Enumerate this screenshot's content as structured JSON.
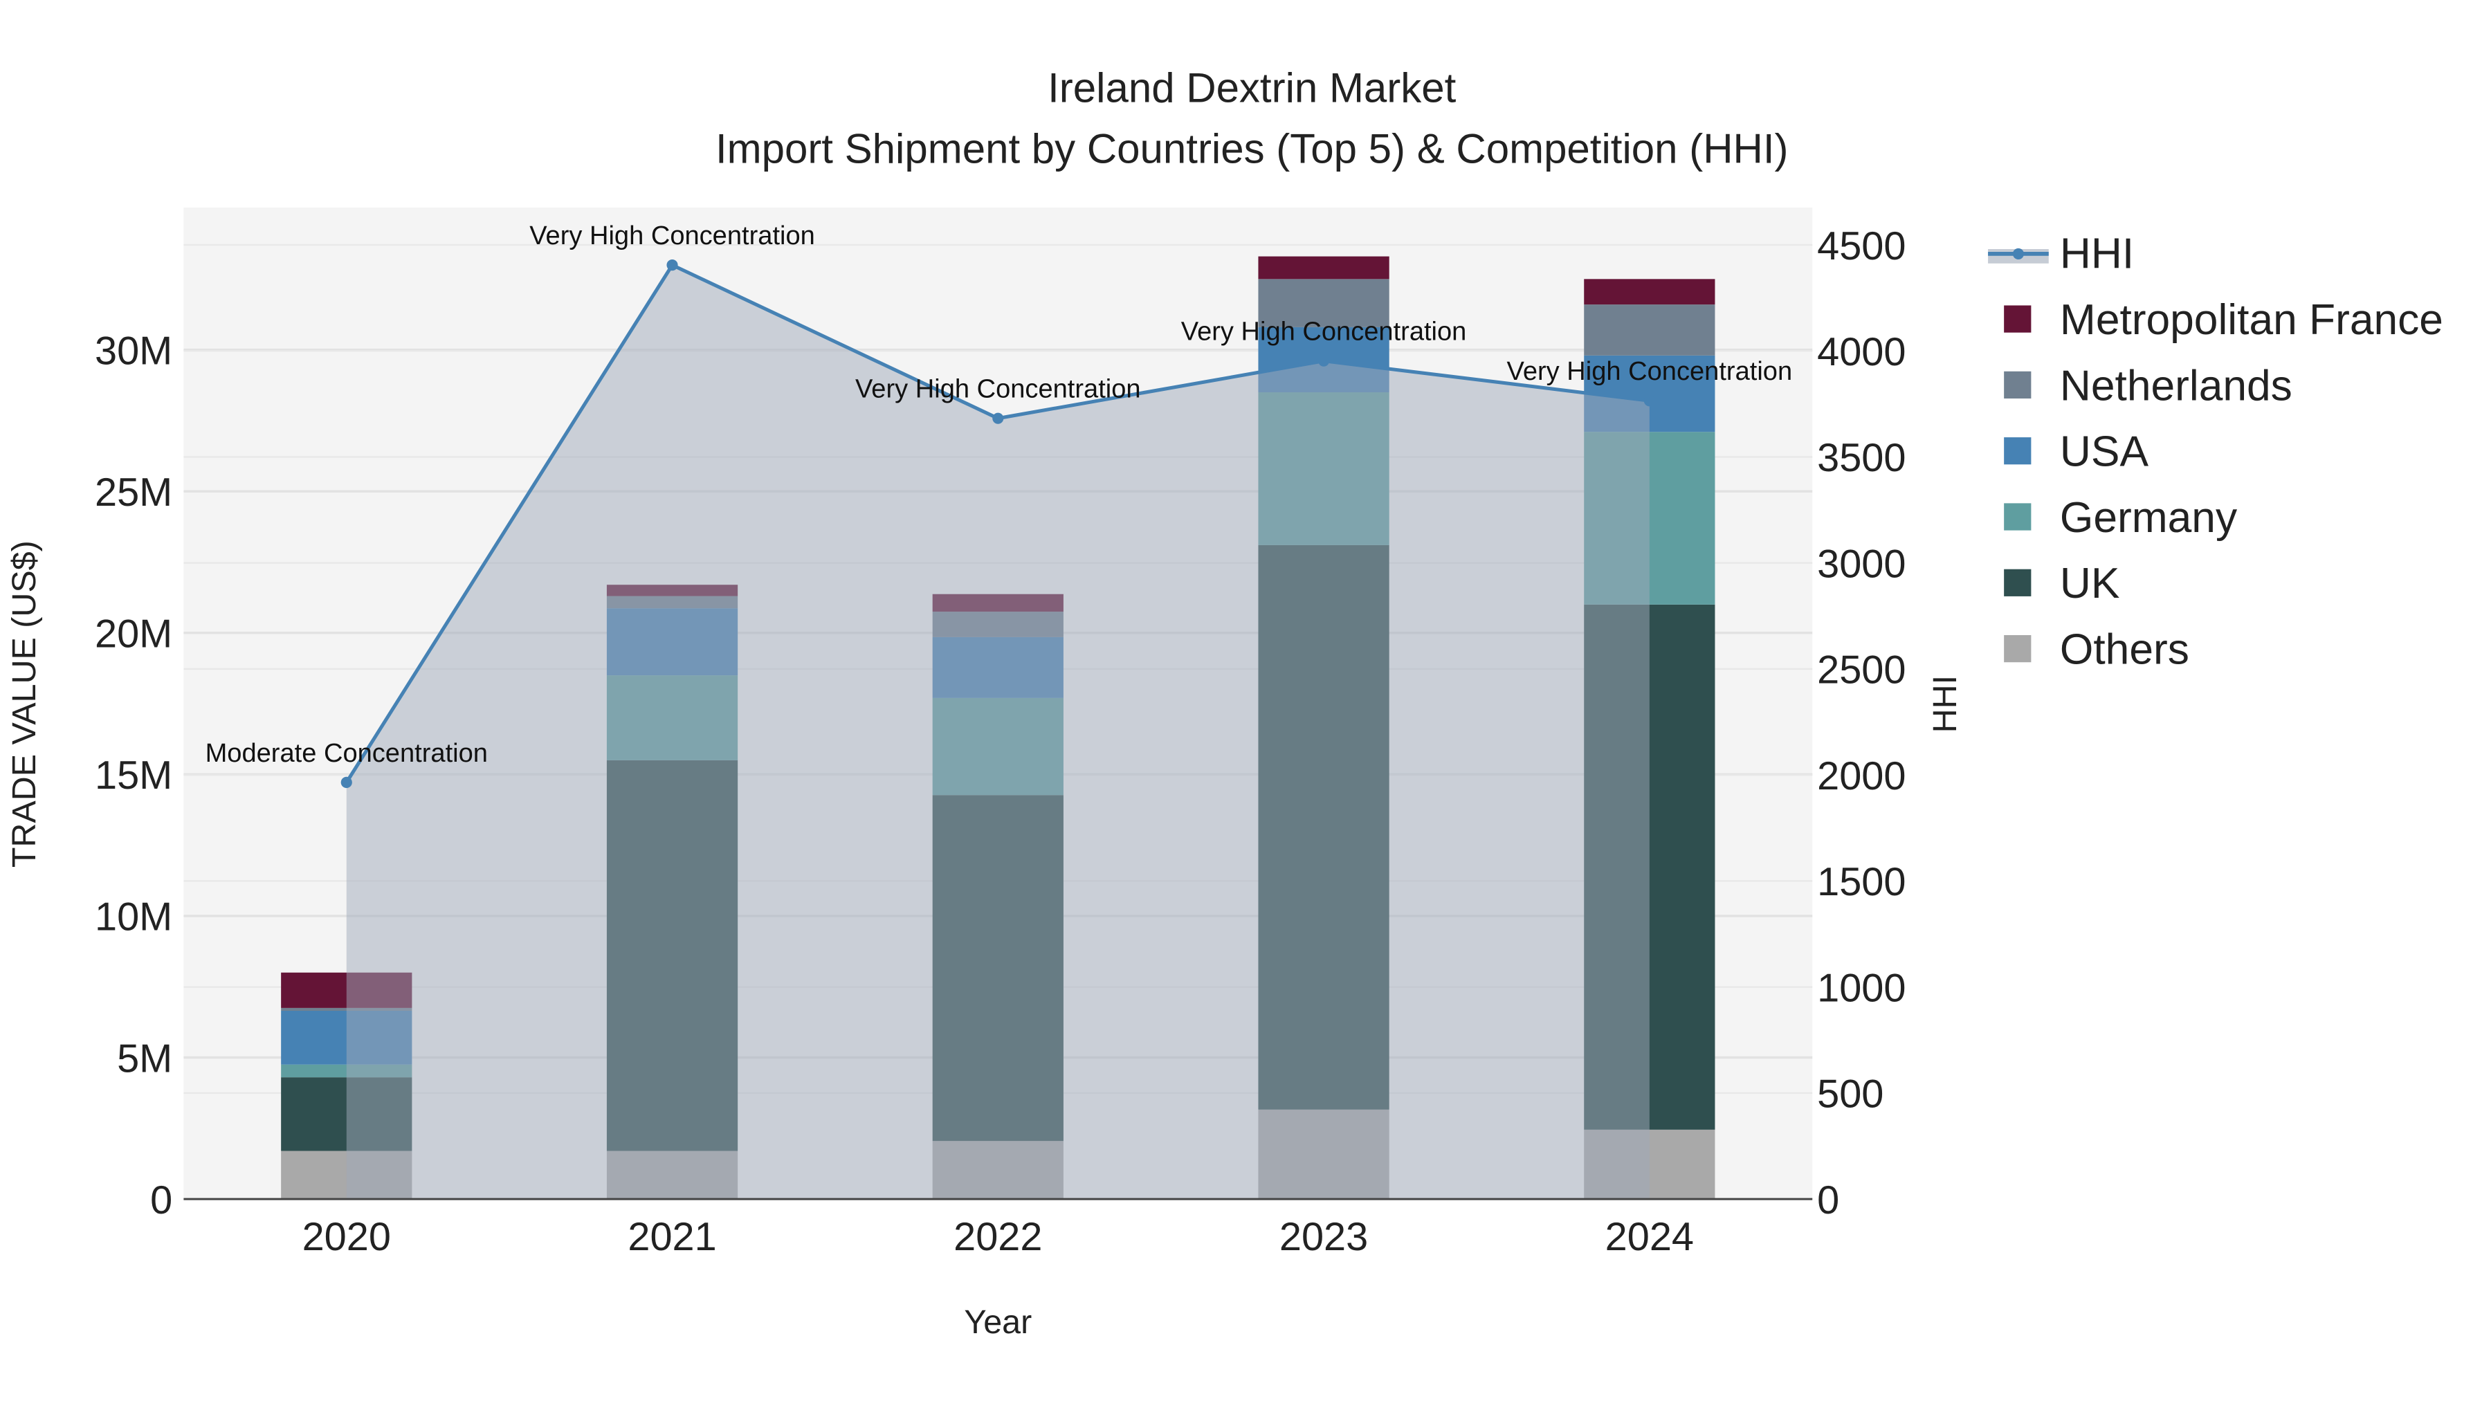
{
  "chart_data": {
    "type": "bar",
    "title": "Ireland Dextrin Market",
    "subtitle": "Import Shipment by Countries (Top 5) & Competition (HHI)",
    "xlabel": "Year",
    "ylabel": "TRADE VALUE (US$)",
    "y2label": "HHI",
    "categories": [
      "2020",
      "2021",
      "2022",
      "2023",
      "2024"
    ],
    "ylim": [
      0,
      35000000
    ],
    "y2lim": [
      0,
      4680
    ],
    "yticks": [
      0,
      5000000,
      10000000,
      15000000,
      20000000,
      25000000,
      30000000
    ],
    "ytick_labels": [
      "0",
      "5M",
      "10M",
      "15M",
      "20M",
      "25M",
      "30M"
    ],
    "y2ticks": [
      0,
      500,
      1000,
      1500,
      2000,
      2500,
      3000,
      3500,
      4000,
      4500
    ],
    "y2tick_labels": [
      "0",
      "500",
      "1000",
      "1500",
      "2000",
      "2500",
      "3000",
      "3500",
      "4000",
      "4500"
    ],
    "series": [
      {
        "name": "Others",
        "color": "#A9A9A9",
        "values": [
          1700000,
          1700000,
          2050000,
          3160000,
          2450000
        ]
      },
      {
        "name": "UK",
        "color": "#2F4F4F",
        "values": [
          2600000,
          13800000,
          12220000,
          19940000,
          18550000
        ]
      },
      {
        "name": "Germany",
        "color": "#5F9EA0",
        "values": [
          450000,
          3000000,
          3430000,
          5400000,
          6100000
        ]
      },
      {
        "name": "USA",
        "color": "#4682B4",
        "values": [
          1900000,
          2370000,
          2150000,
          2300000,
          2700000
        ]
      },
      {
        "name": "Netherlands",
        "color": "#708090",
        "values": [
          100000,
          430000,
          900000,
          1700000,
          1800000
        ]
      },
      {
        "name": "Metropolitan France",
        "color": "#641436",
        "values": [
          1250000,
          400000,
          620000,
          800000,
          900000
        ]
      }
    ],
    "hhi": {
      "name": "HHI",
      "color": "#4682B4",
      "values": [
        1965,
        4405,
        3682,
        3953,
        3765
      ],
      "annotations": [
        "Moderate Concentration",
        "Very High Concentration",
        "Very High Concentration",
        "Very High Concentration",
        "Very High Concentration"
      ]
    },
    "legend_order": [
      "HHI",
      "Metropolitan France",
      "Netherlands",
      "USA",
      "Germany",
      "UK",
      "Others"
    ],
    "legend_placement": "right",
    "grid": true
  }
}
